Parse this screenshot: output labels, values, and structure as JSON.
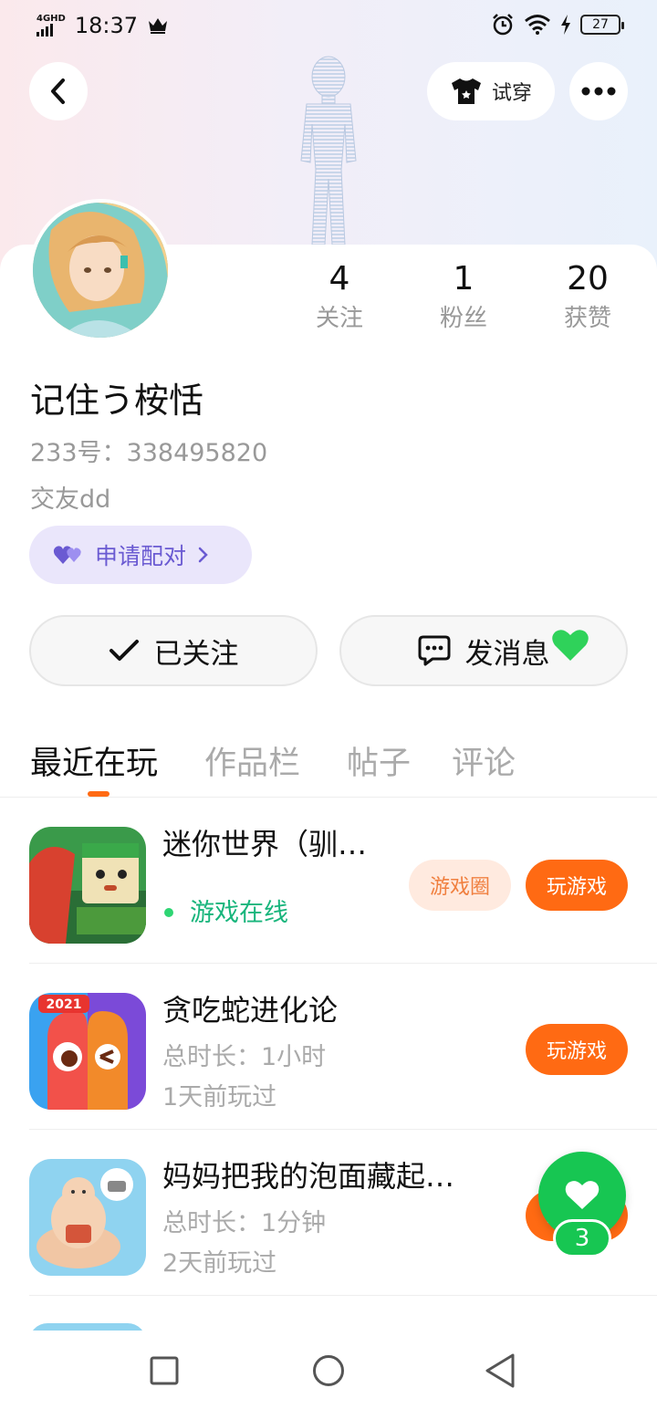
{
  "status_bar": {
    "network": "4GHD",
    "time": "18:37",
    "battery": "27"
  },
  "header": {
    "try_on_label": "试穿"
  },
  "stats": [
    {
      "value": "4",
      "label": "关注"
    },
    {
      "value": "1",
      "label": "粉丝"
    },
    {
      "value": "20",
      "label": "获赞"
    }
  ],
  "profile": {
    "name": "记住う桉恬",
    "id_text": "233号：338495820",
    "bio": "交友dd",
    "pair_label": "申请配对"
  },
  "actions": {
    "followed_label": "已关注",
    "message_label": "发消息"
  },
  "tabs": [
    {
      "label": "最近在玩"
    },
    {
      "label": "作品栏"
    },
    {
      "label": "帖子"
    },
    {
      "label": "评论"
    }
  ],
  "games": [
    {
      "title": "迷你世界（驯…",
      "status": "游戏在线",
      "circle_label": "游戏圈",
      "play_label": "玩游戏"
    },
    {
      "title": "贪吃蛇进化论",
      "duration": "总时长：1小时",
      "last_played": "1天前玩过",
      "play_label": "玩游戏",
      "badge": "2021"
    },
    {
      "title": "妈妈把我的泡面藏起…",
      "duration": "总时长：1分钟",
      "last_played": "2天前玩过",
      "play_label": "玩游戏"
    }
  ],
  "like_fab": {
    "count": "3"
  },
  "colors": {
    "accent": "#ff6a13",
    "online": "#18b57c",
    "pair": "#6a5ad2",
    "like": "#17c652"
  }
}
